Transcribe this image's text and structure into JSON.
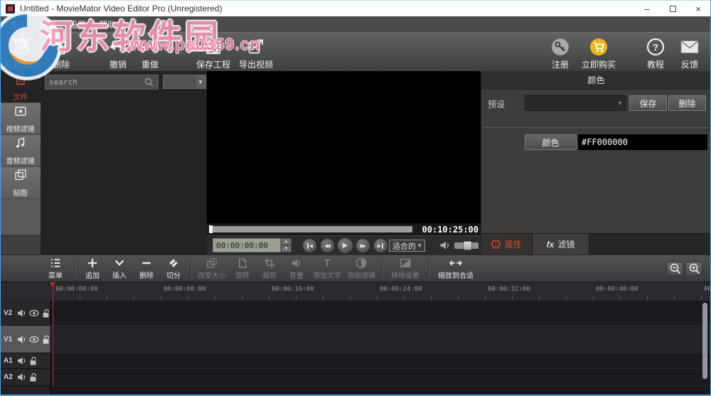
{
  "colors": {
    "window_border": "#45a7e8",
    "accent_red": "#bf4b33",
    "buy_now_yellow": "#eab71c",
    "slider_green": "#1aa076",
    "playhead_red": "#a93327",
    "watermark_pink": "#f695b6"
  },
  "window": {
    "title": "Untitled - MovieMator Video Editor Pro (Unregistered)"
  },
  "menu": {
    "items": [
      {
        "label": "文件"
      },
      {
        "label": "编辑"
      },
      {
        "label": "设置"
      },
      {
        "label": "帮助"
      }
    ]
  },
  "watermark": {
    "site_name": "河东软件园",
    "site_url": "www.pc0359.cn"
  },
  "toolbar": {
    "open_file": "打开文件",
    "delete": "删除",
    "undo": "撤销",
    "redo": "重做",
    "save_project": "保存工程",
    "export_video": "导出视频",
    "register": "注册",
    "buy_now": "立即购买",
    "tutorial": "教程",
    "feedback": "反馈"
  },
  "sidebar": {
    "tabs": [
      {
        "label": "文件"
      },
      {
        "label": "视频滤镜"
      },
      {
        "label": "音频滤镜"
      },
      {
        "label": "贴图"
      }
    ]
  },
  "media_panel": {
    "search_placeholder": "search"
  },
  "preview": {
    "total_duration": "00:10:25:00",
    "current_timecode": "00:00:00:00",
    "fit_mode": "适合的"
  },
  "color_panel": {
    "title": "颜色",
    "preset_label": "预设",
    "save_button": "保存",
    "delete_button": "删除",
    "color_button": "颜色",
    "color_value": "#FF000000",
    "properties_tab": "属性",
    "filters_tab_prefix": "fx",
    "filters_tab": "滤镜"
  },
  "timeline": {
    "menu": "菜单",
    "append": "追加",
    "insert": "插入",
    "remove": "删除",
    "split": "切分",
    "resize": "改变大小",
    "rotate": "旋转",
    "crop": "裁剪",
    "volume": "音量",
    "add_text": "添加文字",
    "add_filter": "添加滤镜",
    "transition_settings": "转场设置",
    "zoom_fit": "缩放到合适",
    "ruler_labels": [
      "00:00:00:00",
      "00:00:08:00",
      "00:00:16:00",
      "00:00:24:00",
      "00:00:32:00",
      "00:00:40:00"
    ],
    "ruler_label_partial": "00",
    "tracks": [
      {
        "name": "V2"
      },
      {
        "name": "V1"
      },
      {
        "name": "A1"
      },
      {
        "name": "A2"
      }
    ]
  },
  "icons": {
    "minimize": "–",
    "close": "×",
    "spin_up": "▲",
    "spin_down": "▼",
    "dropdown_arrow": "▼",
    "select_arrow": "▾",
    "skip_prev": "◀",
    "rewind": "◀◀",
    "play": "▶",
    "fast_forward": "▶▶",
    "skip_next": "▶",
    "tutorial_glyph": "?",
    "add_text_glyph": "T",
    "properties_info_glyph": "i"
  }
}
